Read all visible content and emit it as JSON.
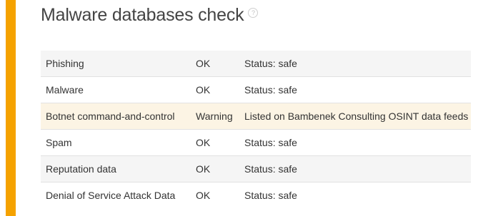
{
  "section": {
    "title": "Malware databases check",
    "help_icon": "question-mark-icon",
    "accent_color": "#f5a200",
    "warning_row_color": "#fcf4e4"
  },
  "checks": [
    {
      "name": "Phishing",
      "result": "OK",
      "details": "Status: safe",
      "status": "ok"
    },
    {
      "name": "Malware",
      "result": "OK",
      "details": "Status: safe",
      "status": "ok"
    },
    {
      "name": "Botnet command-and-control",
      "result": "Warning",
      "details": "Listed on Bambenek Consulting OSINT data feeds",
      "status": "warning"
    },
    {
      "name": "Spam",
      "result": "OK",
      "details": "Status: safe",
      "status": "ok"
    },
    {
      "name": "Reputation data",
      "result": "OK",
      "details": "Status: safe",
      "status": "ok"
    },
    {
      "name": "Denial of Service Attack Data",
      "result": "OK",
      "details": "Status: safe",
      "status": "ok"
    }
  ]
}
